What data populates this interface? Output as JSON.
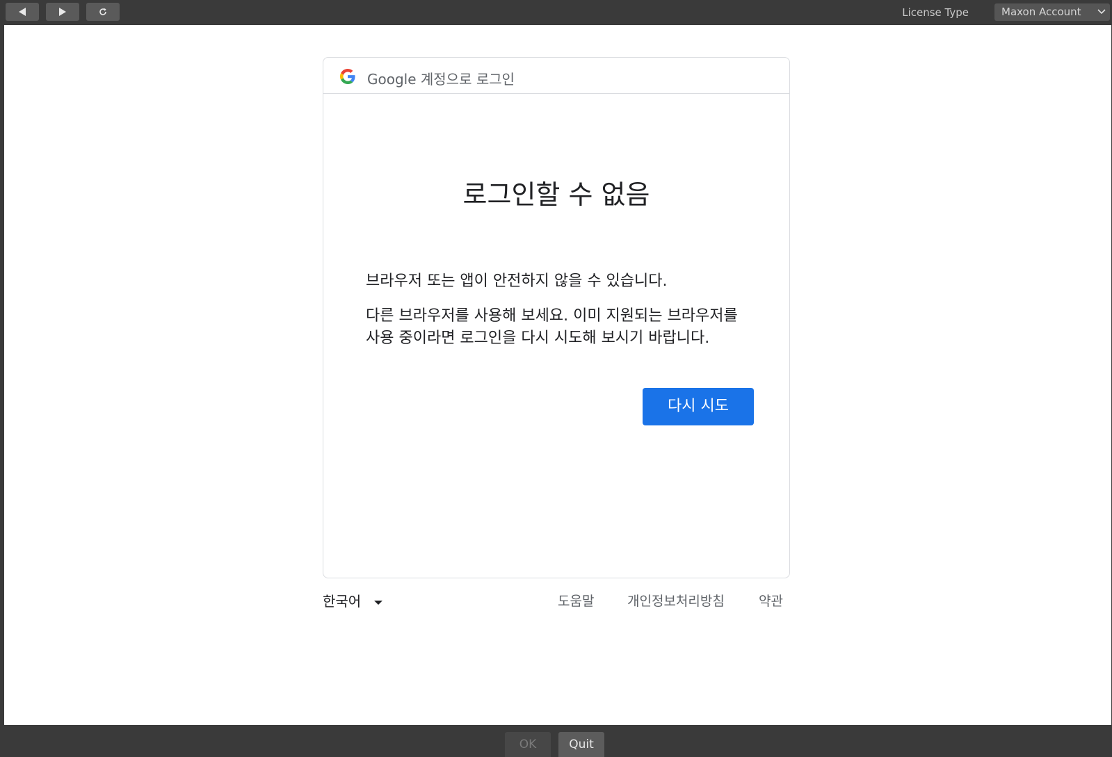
{
  "toolbar": {
    "back_icon": "back-arrow-icon",
    "forward_icon": "forward-arrow-icon",
    "reload_icon": "reload-icon",
    "license_label": "License Type",
    "license_value": "Maxon Account"
  },
  "card": {
    "header_title": "Google 계정으로 로그인",
    "headline": "로그인할 수 없음",
    "paragraph1": "브라우저 또는 앱이 안전하지 않을 수 있습니다.",
    "paragraph2": "다른 브라우저를 사용해 보세요. 이미 지원되는 브라우저를 사용 중이라면 로그인을 다시 시도해 보시기 바랍니다.",
    "retry_label": "다시 시도"
  },
  "footer": {
    "language": "한국어",
    "help": "도움말",
    "privacy": "개인정보처리방침",
    "terms": "약관"
  },
  "bottombar": {
    "ok_label": "OK",
    "quit_label": "Quit"
  },
  "colors": {
    "primary_button": "#1a73e8",
    "chrome_bg": "#3a3a3a"
  }
}
